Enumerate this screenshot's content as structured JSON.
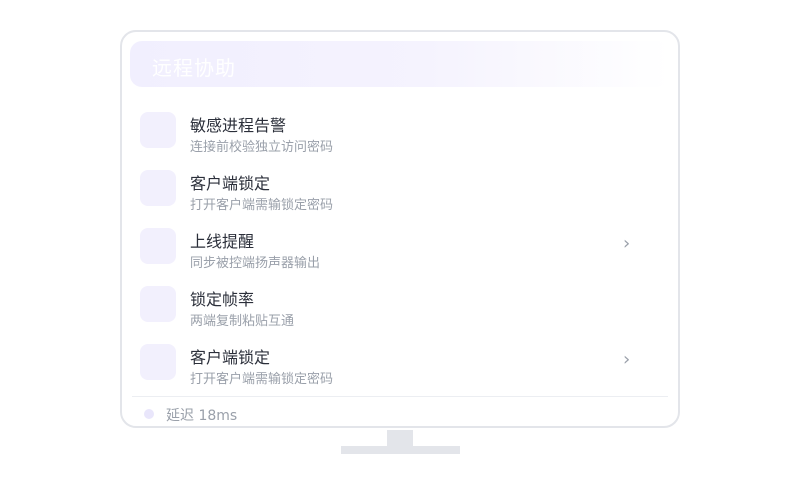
{
  "window": {
    "title": "远程协助"
  },
  "items": [
    {
      "title": "敏感进程告警",
      "subtitle": "连接前校验独立访问密码",
      "chevron": "",
      "icon": "feature-icon"
    },
    {
      "title": "客户端锁定",
      "subtitle": "打开客户端需输锁定密码",
      "chevron": "",
      "icon": "feature-icon"
    },
    {
      "title": "上线提醒",
      "subtitle": "同步被控端扬声器输出",
      "chevron": "›",
      "icon": "feature-icon"
    },
    {
      "title": "锁定帧率",
      "subtitle": "两端复制粘贴互通",
      "chevron": "",
      "icon": "feature-icon"
    },
    {
      "title": "客户端锁定",
      "subtitle": "打开客户端需输锁定密码",
      "chevron": "›",
      "icon": "feature-icon"
    }
  ],
  "status": {
    "text": "延迟 18ms"
  },
  "colors": {
    "accent_soft": "#f2f0fd",
    "border": "#e3e5ea",
    "text_primary": "#2b2f3a",
    "text_secondary": "#9aa0aa"
  }
}
